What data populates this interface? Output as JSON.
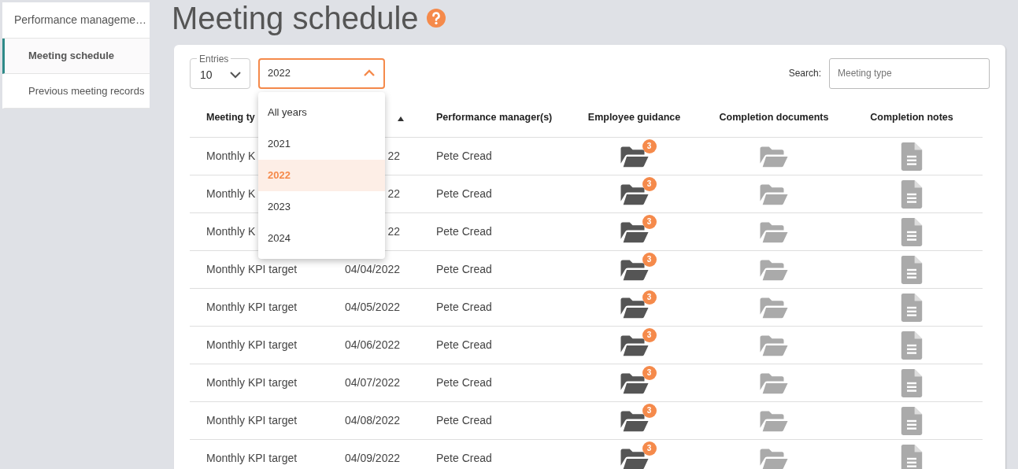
{
  "sidebar": {
    "title": "Performance manageme…",
    "items": [
      {
        "label": "Meeting schedule",
        "selected": true
      },
      {
        "label": "Previous meeting records",
        "selected": false
      }
    ]
  },
  "page_title": "Meeting schedule",
  "filters": {
    "entries": {
      "label": "Entries",
      "value": "10"
    },
    "year": {
      "value": "2022",
      "expanded": true,
      "options": [
        {
          "label": "All years",
          "selected": false
        },
        {
          "label": "2021",
          "selected": false
        },
        {
          "label": "2022",
          "selected": true
        },
        {
          "label": "2023",
          "selected": false
        },
        {
          "label": "2024",
          "selected": false
        }
      ]
    },
    "search": {
      "label": "Search:",
      "placeholder": "Meeting type"
    }
  },
  "table": {
    "columns": [
      "Meeting ty",
      "",
      "Performance manager(s)",
      "Employee guidance",
      "Completion documents",
      "Completion notes"
    ],
    "rows": [
      {
        "type": "Monthly K",
        "date": "22",
        "manager": "Pete Cread",
        "guidance_count": "3"
      },
      {
        "type": "Monthly K",
        "date": "22",
        "manager": "Pete Cread",
        "guidance_count": "3"
      },
      {
        "type": "Monthly K",
        "date": "22",
        "manager": "Pete Cread",
        "guidance_count": "3"
      },
      {
        "type": "Monthly KPI target",
        "date": "04/04/2022",
        "manager": "Pete Cread",
        "guidance_count": "3"
      },
      {
        "type": "Monthly KPI target",
        "date": "04/05/2022",
        "manager": "Pete Cread",
        "guidance_count": "3"
      },
      {
        "type": "Monthly KPI target",
        "date": "04/06/2022",
        "manager": "Pete Cread",
        "guidance_count": "3"
      },
      {
        "type": "Monthly KPI target",
        "date": "04/07/2022",
        "manager": "Pete Cread",
        "guidance_count": "3"
      },
      {
        "type": "Monthly KPI target",
        "date": "04/08/2022",
        "manager": "Pete Cread",
        "guidance_count": "3"
      },
      {
        "type": "Monthly KPI target",
        "date": "04/09/2022",
        "manager": "Pete Cread",
        "guidance_count": "3"
      }
    ]
  }
}
